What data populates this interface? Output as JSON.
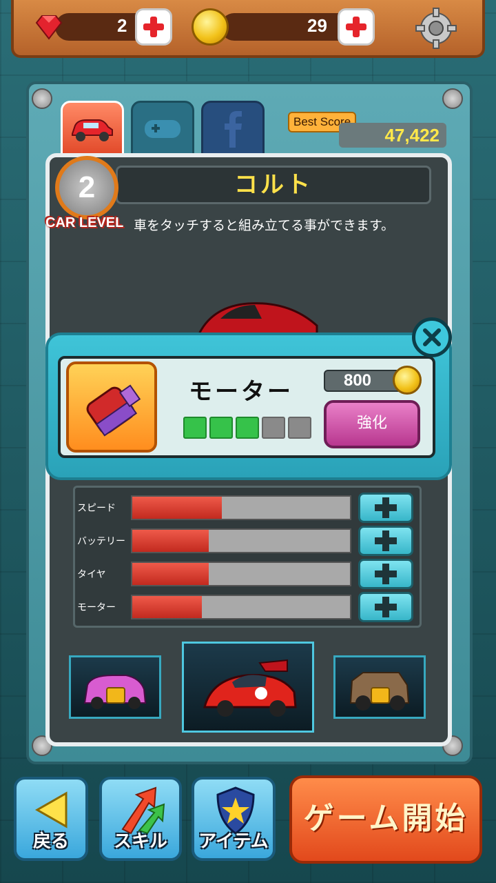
{
  "resources": {
    "gems": "2",
    "coins": "29"
  },
  "best_score": {
    "label": "Best Score",
    "value": "47,422"
  },
  "car": {
    "name": "コルト",
    "level": "2",
    "level_label": "CAR LEVEL",
    "hint": "車をタッチすると組み立てる事ができます。"
  },
  "popup": {
    "part_name": "モーター",
    "price": "800",
    "upgrade_label": "強化",
    "level_filled": 3,
    "level_total": 5
  },
  "stats": [
    {
      "label": "スピード",
      "value": 0.41
    },
    {
      "label": "バッテリー",
      "value": 0.35
    },
    {
      "label": "タイヤ",
      "value": 0.35
    },
    {
      "label": "モーター",
      "value": 0.32
    }
  ],
  "buttons": {
    "back": "戻る",
    "skill": "スキル",
    "item": "アイテム",
    "start": "ゲーム開始"
  },
  "colors": {
    "accent": "#3ec8dc",
    "start": "#e2491c",
    "upgrade": "#b8378f"
  }
}
